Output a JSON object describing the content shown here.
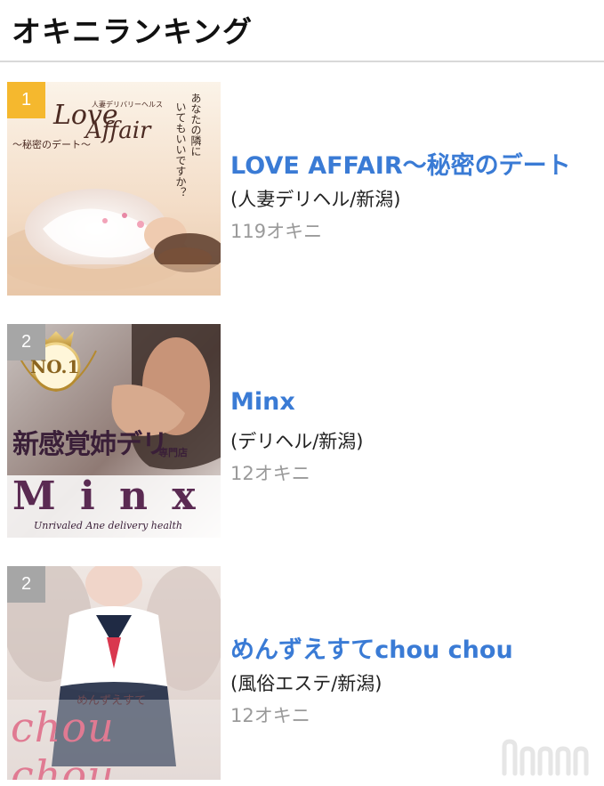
{
  "page": {
    "title": "オキニランキング"
  },
  "colors": {
    "rank1_badge": "#f5b82e",
    "rank_other_badge": "#a6a6a6",
    "link": "#3a7bd5",
    "muted": "#9a9a9a"
  },
  "items": [
    {
      "rank": "1",
      "name": "LOVE AFFAIR〜秘密のデート",
      "category": "(人妻デリヘル/新潟)",
      "okini": "119オキニ",
      "thumb_text": {
        "line1": "Love",
        "line2": "Affair",
        "line3": "〜秘密のデート〜",
        "small": "人妻デリバリーヘルス",
        "vertical1": "あなたの隣に",
        "vertical2": "いてもいいですか？"
      }
    },
    {
      "rank": "2",
      "name": "Minx",
      "category": "(デリヘル/新潟)",
      "okini": "12オキニ",
      "thumb_text": {
        "badge": "NO.1",
        "tagline": "新感覚姉デリ",
        "sub": "専門店",
        "logo": "M i n x",
        "caption": "Unrivaled Ane delivery health"
      }
    },
    {
      "rank": "2",
      "name": "めんずえすてchou chou",
      "category": "(風俗エステ/新潟)",
      "okini": "12オキニ",
      "thumb_text": {
        "small": "めんずえすて",
        "logo": "chou chou"
      }
    }
  ]
}
